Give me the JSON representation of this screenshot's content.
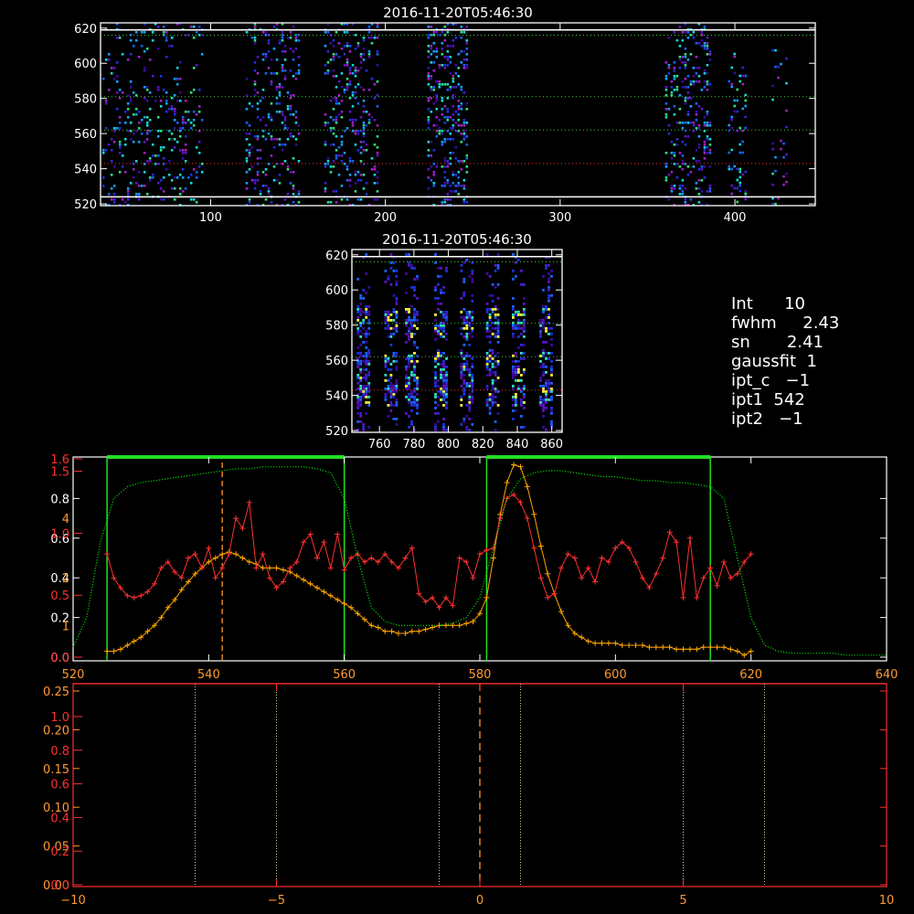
{
  "chart_data": [
    {
      "type": "heatmap",
      "title": "2016-11-20T05:46:30",
      "xlim": [
        37,
        446
      ],
      "ylim": [
        519,
        623
      ],
      "xticks": [
        100,
        200,
        300,
        400
      ],
      "yticks": [
        520,
        540,
        560,
        580,
        600,
        620
      ],
      "hlines_white": [
        524,
        619
      ],
      "hlines_green_dotted": [
        562,
        581,
        616
      ],
      "hlines_red_dotted": [
        543
      ],
      "stripes": [
        {
          "x": [
            38,
            96
          ],
          "y": [
            520,
            623
          ],
          "density": 0.22
        },
        {
          "x": [
            120,
            150
          ],
          "y": [
            520,
            623
          ],
          "density": 0.3
        },
        {
          "x": [
            165,
            195
          ],
          "y": [
            520,
            623
          ],
          "density": 0.34
        },
        {
          "x": [
            224,
            246
          ],
          "y": [
            520,
            623
          ],
          "density": 0.45
        },
        {
          "x": [
            360,
            386
          ],
          "y": [
            520,
            623
          ],
          "density": 0.42
        },
        {
          "x": [
            396,
            406
          ],
          "y": [
            520,
            606
          ],
          "density": 0.28
        },
        {
          "x": [
            421,
            430
          ],
          "y": [
            520,
            608
          ],
          "density": 0.12
        }
      ]
    },
    {
      "type": "heatmap",
      "title": "2016-11-20T05:46:30",
      "xlim": [
        744,
        866
      ],
      "ylim": [
        519,
        623
      ],
      "xticks": [
        760,
        780,
        800,
        820,
        840,
        860
      ],
      "yticks": [
        520,
        540,
        560,
        580,
        600,
        620
      ],
      "hlines_white": [
        619
      ],
      "hlines_green_dotted": [
        562,
        581,
        616
      ],
      "hlines_red_dotted": [
        543
      ],
      "bright_columns": [
        750,
        766,
        778,
        795,
        810,
        825,
        840,
        856
      ]
    },
    {
      "type": "line",
      "xlim": [
        520,
        640
      ],
      "xticks": [
        520,
        540,
        560,
        580,
        600,
        620,
        640
      ],
      "left_axis_white": {
        "ylim": [
          0,
          1
        ],
        "ticks": [
          "0.0",
          "0.2",
          "0.4",
          "0.6",
          "0.8"
        ]
      },
      "left_axis_red": {
        "ylim": [
          0,
          1.6
        ],
        "ticks": [
          "0.0",
          "0.5",
          "1.0",
          "1.5",
          "1.6"
        ]
      },
      "left_axis_orange": {
        "ylim": [
          0,
          4
        ],
        "ticks": [
          "1",
          "2",
          "4"
        ]
      },
      "series": [
        {
          "color": "#ffa500",
          "x": [
            525,
            526,
            527,
            528,
            529,
            530,
            531,
            532,
            533,
            534,
            535,
            536,
            537,
            538,
            539,
            540,
            541,
            542,
            543,
            544,
            545,
            546,
            547,
            548,
            549,
            550,
            551,
            552,
            553,
            554,
            555,
            556,
            557,
            558,
            559,
            560,
            561,
            562,
            563,
            564,
            565,
            566,
            567,
            568,
            569,
            570,
            571,
            572,
            573,
            574,
            575,
            576,
            577,
            578,
            579,
            580,
            581,
            582,
            583,
            584,
            585,
            586,
            587,
            588,
            589,
            590,
            591,
            592,
            593,
            594,
            595,
            596,
            597,
            598,
            599,
            600,
            601,
            602,
            603,
            604,
            605,
            606,
            607,
            608,
            609,
            610,
            611,
            612,
            613,
            614,
            615,
            616,
            617,
            618,
            619,
            620
          ],
          "y": [
            0.03,
            0.03,
            0.04,
            0.06,
            0.08,
            0.1,
            0.13,
            0.16,
            0.2,
            0.25,
            0.29,
            0.34,
            0.38,
            0.42,
            0.45,
            0.48,
            0.5,
            0.52,
            0.53,
            0.52,
            0.5,
            0.48,
            0.47,
            0.45,
            0.45,
            0.45,
            0.44,
            0.43,
            0.41,
            0.39,
            0.37,
            0.35,
            0.33,
            0.31,
            0.29,
            0.27,
            0.25,
            0.22,
            0.19,
            0.16,
            0.15,
            0.13,
            0.13,
            0.12,
            0.12,
            0.13,
            0.13,
            0.14,
            0.15,
            0.16,
            0.16,
            0.16,
            0.16,
            0.17,
            0.18,
            0.22,
            0.3,
            0.5,
            0.72,
            0.88,
            0.97,
            0.96,
            0.86,
            0.72,
            0.56,
            0.42,
            0.32,
            0.23,
            0.16,
            0.12,
            0.1,
            0.08,
            0.07,
            0.07,
            0.07,
            0.07,
            0.06,
            0.06,
            0.06,
            0.06,
            0.05,
            0.05,
            0.05,
            0.05,
            0.04,
            0.04,
            0.04,
            0.04,
            0.05,
            0.05,
            0.05,
            0.05,
            0.04,
            0.03,
            0.01,
            0.03
          ]
        },
        {
          "color": "#ff3030",
          "x": [
            525,
            526,
            527,
            528,
            529,
            530,
            531,
            532,
            533,
            534,
            535,
            536,
            537,
            538,
            539,
            540,
            541,
            542,
            543,
            544,
            545,
            546,
            547,
            548,
            549,
            550,
            551,
            552,
            553,
            554,
            555,
            556,
            557,
            558,
            559,
            560,
            561,
            562,
            563,
            564,
            565,
            566,
            567,
            568,
            569,
            570,
            571,
            572,
            573,
            574,
            575,
            576,
            577,
            578,
            579,
            580,
            581,
            582,
            583,
            584,
            585,
            586,
            587,
            588,
            589,
            590,
            591,
            592,
            593,
            594,
            595,
            596,
            597,
            598,
            599,
            600,
            601,
            602,
            603,
            604,
            605,
            606,
            607,
            608,
            609,
            610,
            611,
            612,
            613,
            614,
            615,
            616,
            617,
            618,
            619,
            620
          ],
          "y": [
            0.52,
            0.4,
            0.35,
            0.31,
            0.3,
            0.31,
            0.33,
            0.37,
            0.45,
            0.48,
            0.43,
            0.4,
            0.5,
            0.52,
            0.45,
            0.55,
            0.4,
            0.45,
            0.52,
            0.7,
            0.65,
            0.78,
            0.45,
            0.52,
            0.4,
            0.35,
            0.38,
            0.45,
            0.48,
            0.58,
            0.62,
            0.5,
            0.58,
            0.45,
            0.62,
            0.44,
            0.5,
            0.52,
            0.48,
            0.5,
            0.48,
            0.52,
            0.48,
            0.45,
            0.5,
            0.55,
            0.32,
            0.28,
            0.3,
            0.25,
            0.3,
            0.26,
            0.5,
            0.48,
            0.4,
            0.52,
            0.54,
            0.55,
            0.7,
            0.8,
            0.82,
            0.78,
            0.7,
            0.55,
            0.4,
            0.3,
            0.32,
            0.45,
            0.52,
            0.5,
            0.4,
            0.45,
            0.38,
            0.5,
            0.48,
            0.55,
            0.58,
            0.55,
            0.48,
            0.4,
            0.35,
            0.42,
            0.5,
            0.63,
            0.58,
            0.3,
            0.6,
            0.3,
            0.4,
            0.45,
            0.36,
            0.48,
            0.4,
            0.42,
            0.48,
            0.52
          ]
        },
        {
          "color": "#00ff00",
          "style": "dotted",
          "x": [
            520,
            522,
            524,
            526,
            528,
            530,
            532,
            534,
            536,
            538,
            540,
            542,
            544,
            546,
            548,
            550,
            552,
            554,
            556,
            558,
            560,
            562,
            564,
            566,
            568,
            570,
            572,
            574,
            576,
            578,
            580,
            582,
            584,
            586,
            588,
            590,
            592,
            594,
            596,
            598,
            600,
            602,
            604,
            606,
            608,
            610,
            612,
            614,
            616,
            618,
            620,
            622,
            624,
            626,
            628,
            630,
            632,
            634,
            636,
            638,
            640
          ],
          "y": [
            0.05,
            0.2,
            0.58,
            0.8,
            0.86,
            0.88,
            0.89,
            0.9,
            0.91,
            0.92,
            0.93,
            0.94,
            0.95,
            0.95,
            0.96,
            0.96,
            0.96,
            0.96,
            0.95,
            0.93,
            0.8,
            0.5,
            0.25,
            0.18,
            0.16,
            0.16,
            0.16,
            0.16,
            0.17,
            0.2,
            0.3,
            0.55,
            0.8,
            0.9,
            0.93,
            0.94,
            0.94,
            0.93,
            0.92,
            0.91,
            0.91,
            0.9,
            0.89,
            0.89,
            0.88,
            0.88,
            0.87,
            0.86,
            0.8,
            0.5,
            0.2,
            0.06,
            0.03,
            0.02,
            0.02,
            0.02,
            0.02,
            0.01,
            0.01,
            0.01,
            0.01
          ]
        }
      ],
      "green_boxes": [
        [
          525,
          560
        ],
        [
          581,
          614
        ]
      ],
      "vline_orange_dashed": 542
    },
    {
      "type": "line",
      "xlim": [
        -10,
        10
      ],
      "xticks": [
        "-10",
        "-5",
        "0",
        "5",
        "10"
      ],
      "left_axis_orange": {
        "ylim": [
          0,
          0.25
        ],
        "ticks": [
          "0.00",
          "0.05",
          "0.10",
          "0.15",
          "0.20",
          "0.25"
        ]
      },
      "left_axis_red": {
        "ylim": [
          0,
          1.0
        ],
        "ticks": [
          "0.0",
          "0.2",
          "0.4",
          "0.6",
          "0.8",
          "1.0"
        ]
      },
      "vlines_dotted": [
        -7,
        -5,
        -1,
        1,
        5,
        7
      ],
      "vline_orange_dashed": 0
    }
  ],
  "fit_panel": {
    "text": "Int      10\nfwhm     2.43\nsn       2.41\ngaussfit  1\nipt_c   −1\nipt1  542\nipt2   −1"
  }
}
